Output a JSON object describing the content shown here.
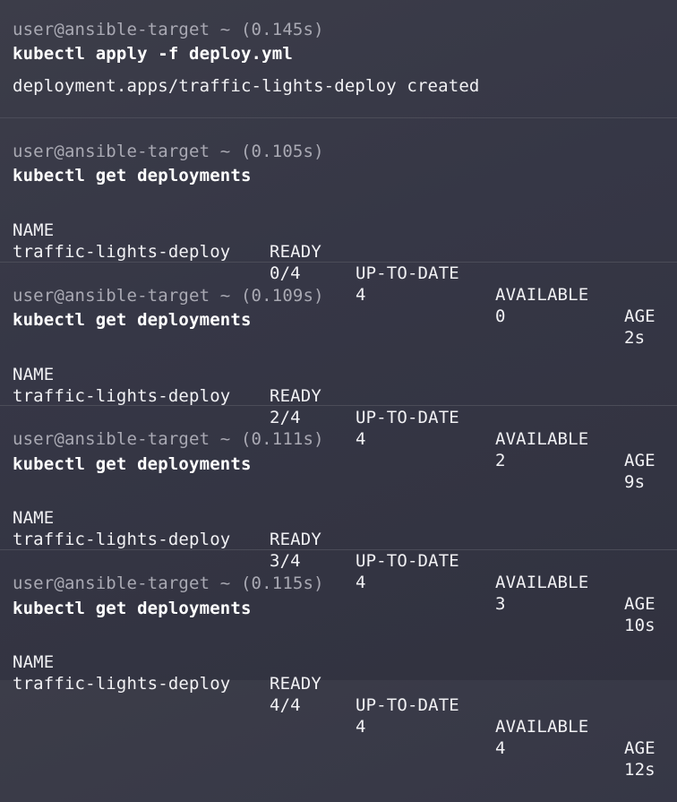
{
  "blocks": [
    {
      "prompt": "user@ansible-target ~ (0.145s)",
      "command": "kubectl apply -f deploy.yml",
      "output": "deployment.apps/traffic-lights-deploy created"
    },
    {
      "prompt": "user@ansible-target ~ (0.105s)",
      "command": "kubectl get deployments",
      "table": {
        "headers": [
          "NAME",
          "READY",
          "UP-TO-DATE",
          "AVAILABLE",
          "AGE"
        ],
        "row": [
          "traffic-lights-deploy",
          "0/4",
          "4",
          "0",
          "2s"
        ]
      }
    },
    {
      "prompt": "user@ansible-target ~ (0.109s)",
      "command": "kubectl get deployments",
      "table": {
        "headers": [
          "NAME",
          "READY",
          "UP-TO-DATE",
          "AVAILABLE",
          "AGE"
        ],
        "row": [
          "traffic-lights-deploy",
          "2/4",
          "4",
          "2",
          "9s"
        ]
      }
    },
    {
      "prompt": "user@ansible-target ~ (0.111s)",
      "command": "kubectl get deployments",
      "table": {
        "headers": [
          "NAME",
          "READY",
          "UP-TO-DATE",
          "AVAILABLE",
          "AGE"
        ],
        "row": [
          "traffic-lights-deploy",
          "3/4",
          "4",
          "3",
          "10s"
        ]
      }
    },
    {
      "prompt": "user@ansible-target ~ (0.115s)",
      "command": "kubectl get deployments",
      "table": {
        "headers": [
          "NAME",
          "READY",
          "UP-TO-DATE",
          "AVAILABLE",
          "AGE"
        ],
        "row": [
          "traffic-lights-deploy",
          "4/4",
          "4",
          "4",
          "12s"
        ]
      }
    }
  ]
}
